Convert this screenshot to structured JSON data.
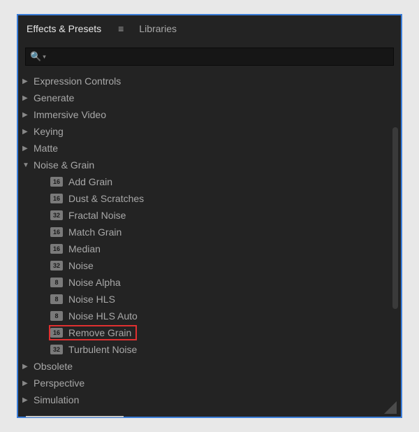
{
  "tabs": {
    "effects": "Effects & Presets",
    "libraries": "Libraries"
  },
  "search": {
    "placeholder": ""
  },
  "categories": {
    "expression_controls": "Expression Controls",
    "generate": "Generate",
    "immersive_video": "Immersive Video",
    "keying": "Keying",
    "matte": "Matte",
    "noise_grain": "Noise & Grain",
    "obsolete": "Obsolete",
    "perspective": "Perspective",
    "simulation": "Simulation"
  },
  "effects": {
    "add_grain": {
      "bit": "16",
      "label": "Add Grain"
    },
    "dust_scratches": {
      "bit": "16",
      "label": "Dust & Scratches"
    },
    "fractal_noise": {
      "bit": "32",
      "label": "Fractal Noise"
    },
    "match_grain": {
      "bit": "16",
      "label": "Match Grain"
    },
    "median": {
      "bit": "16",
      "label": "Median"
    },
    "noise": {
      "bit": "32",
      "label": "Noise"
    },
    "noise_alpha": {
      "bit": "8",
      "label": "Noise Alpha"
    },
    "noise_hls": {
      "bit": "8",
      "label": "Noise HLS"
    },
    "noise_hls_auto": {
      "bit": "8",
      "label": "Noise HLS Auto"
    },
    "remove_grain": {
      "bit": "16",
      "label": "Remove Grain"
    },
    "turbulent_noise": {
      "bit": "32",
      "label": "Turbulent Noise"
    }
  }
}
